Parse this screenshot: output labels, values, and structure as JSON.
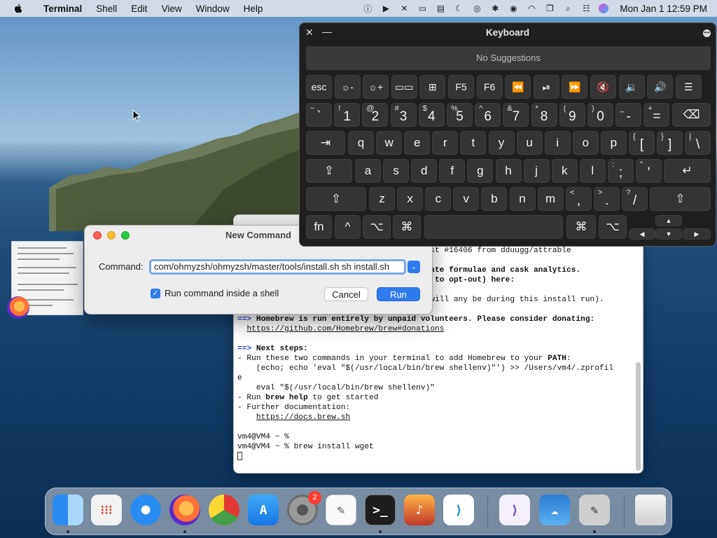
{
  "menubar": {
    "app": "Terminal",
    "items": [
      "Shell",
      "Edit",
      "View",
      "Window",
      "Help"
    ],
    "clock": "Mon Jan 1  12:59 PM"
  },
  "terminal": {
    "lines": [
      {
        "t": "                                        est #16406 from dduugg/attrable",
        "s": "plain"
      },
      {
        "t": "",
        "s": "plain"
      },
      {
        "t": "                                        gate formulae and cask analytics.",
        "s": "b"
      },
      {
        "t": "                                        w to opt-out) here:",
        "s": "b"
      },
      {
        "t": "",
        "s": "plain"
      },
      {
        "t": "                                         will any be during this install run).",
        "s": "plain"
      },
      {
        "t": "",
        "s": "plain"
      },
      {
        "t": "==> Homebrew is run entirely by unpaid volunteers. Please consider donating:",
        "s": "arrowb"
      },
      {
        "t": "  https://github.com/Homebrew/brew#donations",
        "s": "u"
      },
      {
        "t": "",
        "s": "plain"
      },
      {
        "t": "==> Next steps:",
        "s": "arrowb"
      },
      {
        "t": "- Run these two commands in your terminal to add Homebrew to your PATH:",
        "s": "path"
      },
      {
        "t": "    (echo; echo 'eval \"$(/usr/local/bin/brew shellenv)\"') >> /Users/vm4/.zprofil",
        "s": "plain"
      },
      {
        "t": "e",
        "s": "plain"
      },
      {
        "t": "    eval \"$(/usr/local/bin/brew shellenv)\"",
        "s": "plain"
      },
      {
        "t": "- Run brew help to get started",
        "s": "brewhelp"
      },
      {
        "t": "- Further documentation:",
        "s": "plain"
      },
      {
        "t": "    https://docs.brew.sh",
        "s": "u"
      },
      {
        "t": "",
        "s": "plain"
      },
      {
        "t": "vm4@VM4 ~ %",
        "s": "plain"
      },
      {
        "t": "vm4@VM4 ~ % brew install wget",
        "s": "plain"
      }
    ]
  },
  "dialog": {
    "title": "New Command",
    "command_label": "Command:",
    "command_value": "com/ohmyzsh/ohmyzsh/master/tools/install.sh sh install.sh",
    "checkbox_label": "Run command inside a shell",
    "cancel_label": "Cancel",
    "run_label": "Run"
  },
  "keyboard": {
    "title": "Keyboard",
    "suggestions": "No Suggestions",
    "fn_row": [
      "esc",
      "☼-",
      "☼+",
      "▭▭",
      "⊞",
      "F5",
      "F6",
      "⏪",
      "⏯",
      "⏩",
      "🔇",
      "🔉",
      "🔊",
      "☰"
    ],
    "num_row": [
      [
        "~",
        "`"
      ],
      [
        "!",
        "1"
      ],
      [
        "@",
        "2"
      ],
      [
        "#",
        "3"
      ],
      [
        "$",
        "4"
      ],
      [
        "%",
        "5"
      ],
      [
        "^",
        "6"
      ],
      [
        "&",
        "7"
      ],
      [
        "*",
        "8"
      ],
      [
        "(",
        "9"
      ],
      [
        ")",
        "0"
      ],
      [
        "_",
        "-"
      ],
      [
        "+",
        "="
      ]
    ],
    "row_q": [
      "q",
      "w",
      "e",
      "r",
      "t",
      "y",
      "u",
      "i",
      "o",
      "p"
    ],
    "row_q_extra": [
      [
        "{",
        "["
      ],
      [
        "}",
        "]"
      ],
      [
        "|",
        "\\"
      ]
    ],
    "row_a": [
      "a",
      "s",
      "d",
      "f",
      "g",
      "h",
      "j",
      "k",
      "l"
    ],
    "row_a_extra": [
      [
        ":",
        ";"
      ],
      [
        "\"",
        "'"
      ]
    ],
    "row_z": [
      "z",
      "x",
      "c",
      "v",
      "b",
      "n",
      "m"
    ],
    "row_z_extra": [
      [
        "<",
        ","
      ],
      [
        ">",
        "."
      ],
      [
        "?",
        "/"
      ]
    ],
    "mod": {
      "fn": "fn",
      "ctrl": "^",
      "opt": "⌥",
      "cmd": "⌘"
    },
    "tab": "⇥",
    "caps": "⇪",
    "shift": "⇧",
    "enter": "↵",
    "backspace": "⌫",
    "arrows": {
      "up": "▲",
      "down": "▼",
      "left": "◀",
      "right": "▶"
    }
  },
  "dock": {
    "badge": "2",
    "apps": [
      "finder",
      "launchpad",
      "safari",
      "firefox",
      "chrome",
      "app-store",
      "system-preferences",
      "textedit",
      "terminal",
      "garageband",
      "vscode",
      "visual-studio",
      "weather",
      "script-editor",
      "trash"
    ]
  }
}
